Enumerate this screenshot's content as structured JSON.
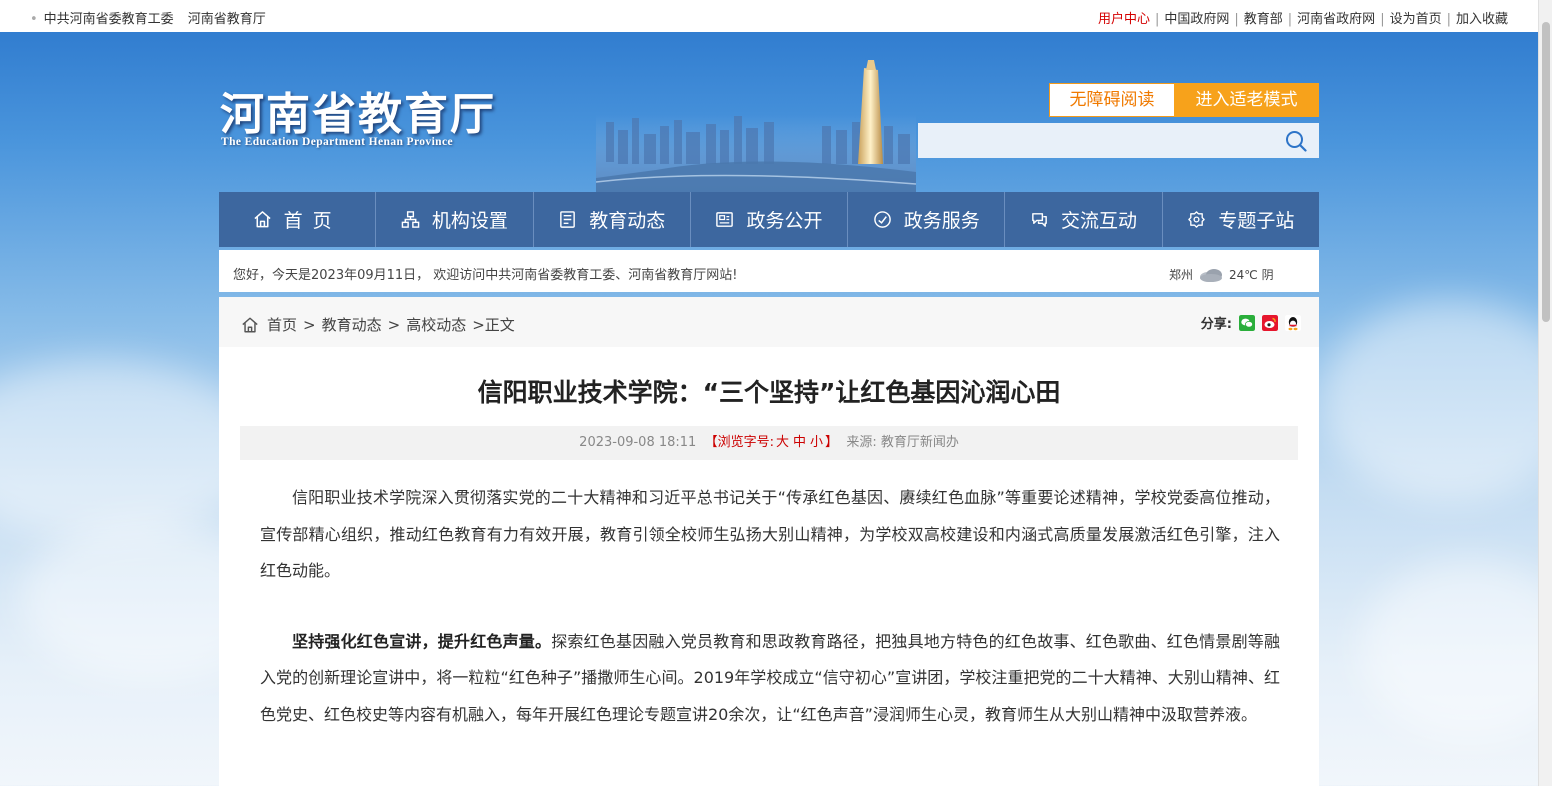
{
  "topbar": {
    "left_links": [
      "中共河南省委教育工委",
      "河南省教育厅"
    ],
    "right_links": [
      "用户中心",
      "中国政府网",
      "教育部",
      "河南省政府网",
      "设为首页",
      "加入收藏"
    ]
  },
  "header": {
    "logo_cn": "河南省教育厅",
    "logo_en": "The Education Department Henan Province",
    "accessibility_label": "无障碍阅读",
    "elder_mode_label": "进入适老模式",
    "search": {
      "placeholder": ""
    }
  },
  "nav": [
    {
      "label": "首页",
      "icon": "home-icon"
    },
    {
      "label": "机构设置",
      "icon": "org-icon"
    },
    {
      "label": "教育动态",
      "icon": "news-icon"
    },
    {
      "label": "政务公开",
      "icon": "gov-icon"
    },
    {
      "label": "政务服务",
      "icon": "service-icon"
    },
    {
      "label": "交流互动",
      "icon": "chat-icon"
    },
    {
      "label": "专题子站",
      "icon": "topic-icon"
    }
  ],
  "welcome": {
    "message": "您好，今天是2023年09月11日， 欢迎访问中共河南省委教育工委、河南省教育厅网站!",
    "city": "郑州",
    "temperature": "24℃",
    "condition": "阴"
  },
  "breadcrumb": {
    "items": [
      "首页",
      "教育动态",
      "高校动态"
    ],
    "current": "正文",
    "share_label": "分享:"
  },
  "article": {
    "title": "信阳职业技术学院：“三个坚持”让红色基因沁润心田",
    "date": "2023-09-08 18:11",
    "font_size_prefix": "【浏览字号:",
    "font_sizes": [
      "大",
      "中",
      "小"
    ],
    "font_size_suffix": "】",
    "source": "来源: 教育厅新闻办",
    "para1": "信阳职业技术学院深入贯彻落实党的二十大精神和习近平总书记关于“传承红色基因、赓续红色血脉”等重要论述精神，学校党委高位推动，宣传部精心组织，推动红色教育有力有效开展，教育引领全校师生弘扬大别山精神，为学校双高校建设和内涵式高质量发展激活红色引擎，注入红色动能。",
    "para2_bold": "坚持强化红色宣讲，提升红色声量。",
    "para2_rest": "探索红色基因融入党员教育和思政教育路径，把独具地方特色的红色故事、红色歌曲、红色情景剧等融入党的创新理论宣讲中，将一粒粒“红色种子”播撒师生心间。2019年学校成立“信守初心”宣讲团，学校注重把党的二十大精神、大别山精神、红色党史、红色校史等内容有机融入，每年开展红色理论专题宣讲20余次，让“红色声音”浸润师生心灵，教育师生从大别山精神中汲取营养液。"
  },
  "colors": {
    "nav_bg": "#3d679f",
    "accent_orange": "#f7a21b",
    "highlight_red": "#d40000"
  }
}
